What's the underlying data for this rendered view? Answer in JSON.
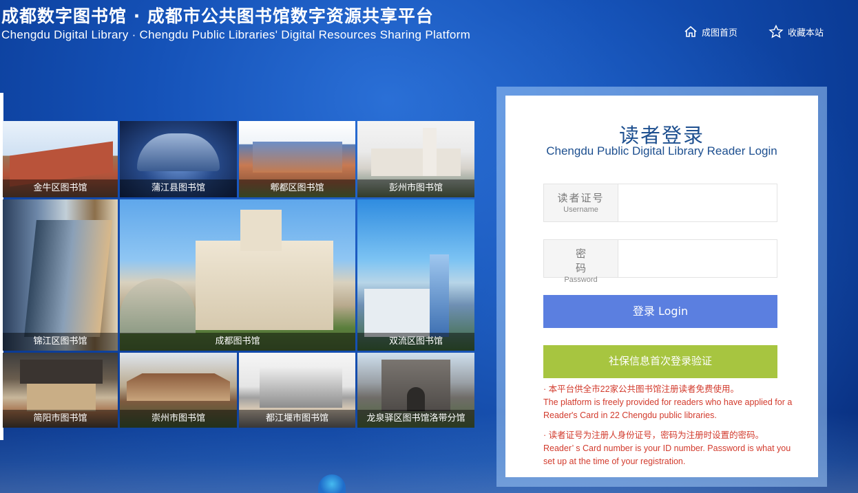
{
  "header": {
    "title": "成都数字图书馆 · 成都市公共图书馆数字资源共享平台",
    "subtitle": "Chengdu Digital Library · Chengdu Public Libraries' Digital Resources Sharing Platform",
    "nav": [
      {
        "label": "成图首页",
        "icon": "home-icon"
      },
      {
        "label": "收藏本站",
        "icon": "star-icon"
      }
    ]
  },
  "libraries": [
    "金牛区图书馆",
    "蒲江县图书馆",
    "郫都区图书馆",
    "彭州市图书馆",
    "锦江区图书馆",
    "成都图书馆",
    "双流区图书馆",
    "简阳市图书馆",
    "崇州市图书馆",
    "都江堰市图书馆",
    "龙泉驿区图书馆洛带分馆"
  ],
  "login": {
    "title": "读者登录",
    "subtitle": "Chengdu Public Digital Library Reader Login",
    "username": {
      "label_cn": "读者证号",
      "label_en": "Username",
      "value": "",
      "placeholder": ""
    },
    "password": {
      "label_cn": "密 码",
      "label_en": "Password",
      "value": "",
      "placeholder": ""
    },
    "login_button": "登录 Login",
    "social_button": "社保信息首次登录验证",
    "notes": [
      "· 本平台供全市22家公共图书馆注册读者免费使用。",
      "The platform is freely provided for readers who have applied for a Reader's Card in 22 Chengdu public libraries.",
      "· 读者证号为注册人身份证号，密码为注册时设置的密码。",
      "Reader’ s Card number is your ID number. Password is what you set up at the time of your registration."
    ]
  },
  "colors": {
    "background": "#1552b8",
    "login_button": "#5b7fe0",
    "social_button": "#a7c540",
    "note_text": "#d23a2c",
    "title_text": "#1d4f8f"
  }
}
